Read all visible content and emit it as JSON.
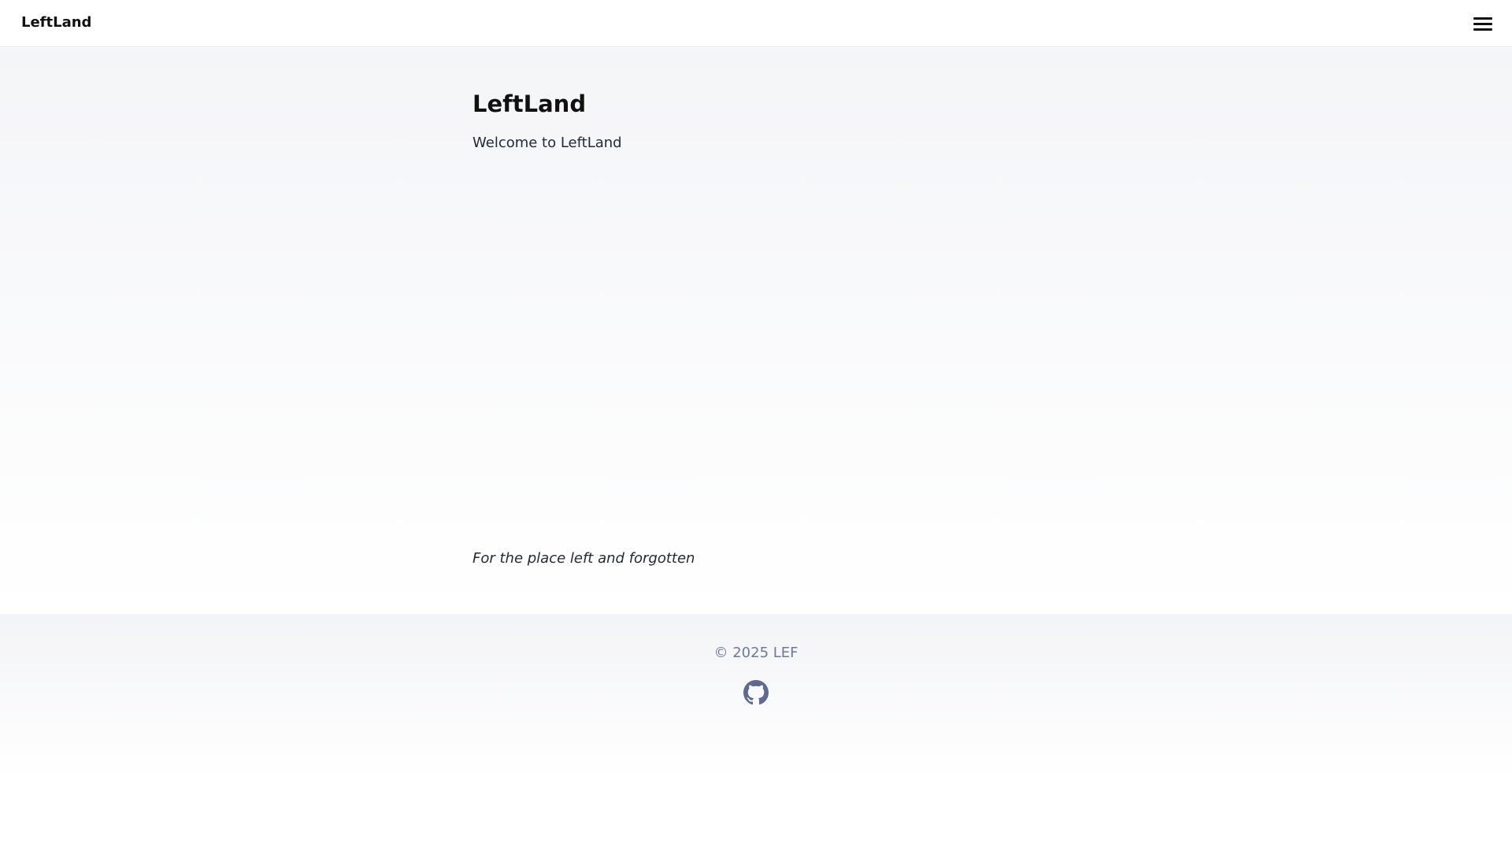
{
  "header": {
    "brand": "LeftLand",
    "menu_icon": "hamburger-menu-icon"
  },
  "main": {
    "title": "LeftLand",
    "welcome": "Welcome to LeftLand",
    "tagline": "For the place left and forgotten"
  },
  "footer": {
    "copyright": "© 2025 LEF",
    "github_icon": "github-icon"
  },
  "colors": {
    "text_primary": "#111111",
    "text_body": "#1f2937",
    "footer_text": "#6b7a99",
    "github_icon": "#5d6b8f",
    "header_border": "#e3e5ea"
  }
}
